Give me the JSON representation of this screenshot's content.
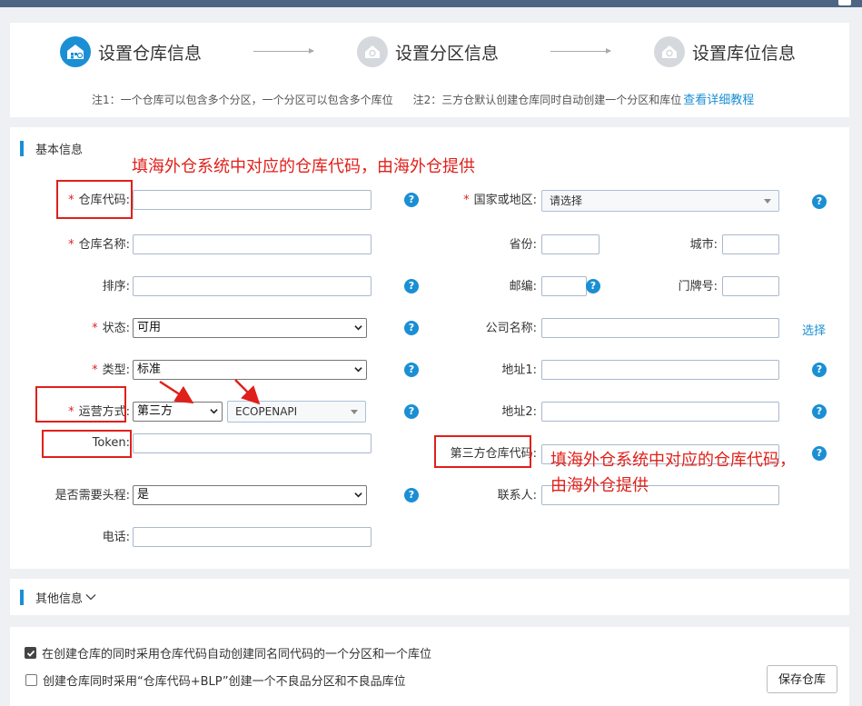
{
  "steps": [
    {
      "label": "设置仓库信息",
      "icon": "warehouse-icon",
      "active": true
    },
    {
      "label": "设置分区信息",
      "icon": "circle-step-icon",
      "active": false
    },
    {
      "label": "设置库位信息",
      "icon": "circle-step-icon",
      "active": false
    }
  ],
  "notes": {
    "note1": "注1：一个仓库可以包含多个分区，一个分区可以包含多个库位",
    "note2": "注2：三方仓默认创建仓库同时自动创建一个分区和库位",
    "help_link": "查看详细教程"
  },
  "basic": {
    "section_title": "基本信息",
    "fields": {
      "warehouse_code": {
        "label": "仓库代码:",
        "required": true,
        "value": ""
      },
      "warehouse_name": {
        "label": "仓库名称:",
        "required": true,
        "value": ""
      },
      "sort": {
        "label": "排序:",
        "value": ""
      },
      "status": {
        "label": "状态:",
        "required": true,
        "value": "可用"
      },
      "type": {
        "label": "类型:",
        "required": true,
        "value": "标准"
      },
      "operation_mode": {
        "label": "运营方式:",
        "required": true,
        "value": "第三方",
        "provider": "ECOPENAPI"
      },
      "token": {
        "label": "Token:",
        "value": ""
      },
      "need_first_leg": {
        "label": "是否需要头程:",
        "value": "是"
      },
      "phone": {
        "label": "电话:",
        "value": ""
      },
      "country": {
        "label": "国家或地区:",
        "required": true,
        "value": "请选择"
      },
      "province": {
        "label": "省份:",
        "value": ""
      },
      "city": {
        "label": "城市:",
        "value": ""
      },
      "postcode": {
        "label": "邮编:",
        "value": ""
      },
      "door_no": {
        "label": "门牌号:",
        "value": ""
      },
      "company": {
        "label": "公司名称:",
        "value": "",
        "select_link": "选择"
      },
      "address1": {
        "label": "地址1:",
        "value": ""
      },
      "address2": {
        "label": "地址2:",
        "value": ""
      },
      "third_party_code": {
        "label": "第三方仓库代码:",
        "value": ""
      },
      "contact": {
        "label": "联系人:",
        "value": ""
      }
    }
  },
  "annotations": {
    "top_text": "填海外仓系统中对应的仓库代码，由海外仓提供",
    "right_text_line1": "填海外仓系统中对应的仓库代码，",
    "right_text_line2": "由海外仓提供",
    "color": "#e0201a"
  },
  "other": {
    "section_title": "其他信息"
  },
  "footer": {
    "option1": {
      "label": "在创建仓库的同时采用仓库代码自动创建同名同代码的一个分区和一个库位",
      "checked": true
    },
    "option2": {
      "label": "创建仓库同时采用“仓库代码+BLP”创建一个不良品分区和不良品库位",
      "checked": false
    },
    "save_label": "保存仓库"
  },
  "colors": {
    "accent": "#1a8fd4",
    "required": "#e02020",
    "annotation": "#e0201a"
  }
}
